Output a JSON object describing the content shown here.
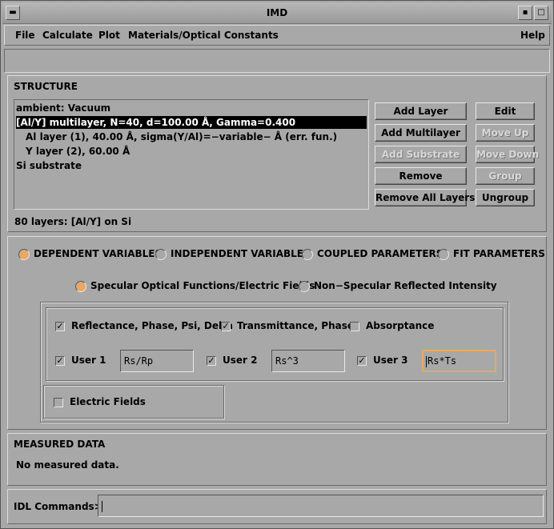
{
  "window": {
    "title": "IMD"
  },
  "menubar": {
    "items": [
      "File",
      "Calculate",
      "Plot",
      "Materials/Optical Constants"
    ],
    "help": "Help"
  },
  "structure": {
    "section_label": "STRUCTURE",
    "layers": [
      "ambient: Vacuum",
      "[Al/Y] multilayer, N=40, d=100.00 Å, Gamma=0.400",
      "Al layer (1), 40.00 Å, sigma(Y/Al)=−variable− Å (err. fun.)",
      "Y layer (2), 60.00 Å",
      "Si substrate"
    ],
    "selected_index": 1,
    "summary": "80 layers: [Al/Y] on Si",
    "buttons": {
      "add_layer": "Add Layer",
      "edit": "Edit",
      "add_multilayer": "Add Multilayer",
      "move_up": "Move Up",
      "add_substrate": "Add Substrate",
      "move_down": "Move Down",
      "remove": "Remove",
      "group": "Group",
      "remove_all": "Remove All Layers",
      "ungroup": "Ungroup"
    }
  },
  "variables": {
    "tabs": [
      "DEPENDENT VARIABLES",
      "INDEPENDENT VARIABLES",
      "COUPLED PARAMETERS",
      "FIT PARAMETERS"
    ],
    "selected_tab": 0,
    "modes": [
      "Specular Optical Functions/Electric Fields",
      "Non−Specular Reflected Intensity"
    ],
    "selected_mode": 0,
    "checks": {
      "reflectance": {
        "label": "Reflectance, Phase, Psi, Delta",
        "checked": true
      },
      "transmittance": {
        "label": "Transmittance, Phase",
        "checked": true
      },
      "absorptance": {
        "label": "Absorptance",
        "checked": false
      },
      "user1": {
        "label": "User 1",
        "checked": true,
        "value": "Rs/Rp"
      },
      "user2": {
        "label": "User 2",
        "checked": true,
        "value": "Rs^3"
      },
      "user3": {
        "label": "User 3",
        "checked": true,
        "value": "Rs*Ts"
      },
      "electric": {
        "label": "Electric Fields",
        "checked": false
      }
    }
  },
  "measured": {
    "section_label": "MEASURED DATA",
    "text": "No measured data."
  },
  "command": {
    "label": "IDL Commands>",
    "value": ""
  },
  "colors": {
    "background": "#a8a8a8",
    "accent": "#e8a868",
    "selection": "#000000"
  }
}
